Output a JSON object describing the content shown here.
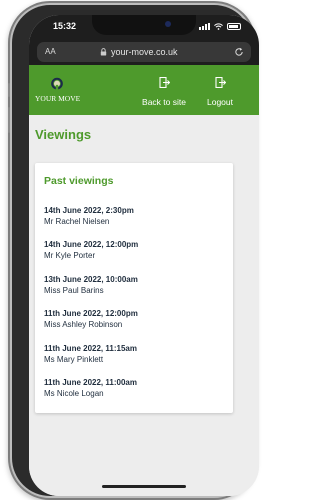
{
  "status_bar": {
    "time": "15:32"
  },
  "browser": {
    "text_size_label": "AA",
    "url": "your-move.co.uk"
  },
  "header": {
    "logo_text": "YOUR MOVE",
    "back_label": "Back to site",
    "logout_label": "Logout",
    "color": "#4e9a2c"
  },
  "page": {
    "title": "Viewings"
  },
  "card": {
    "title": "Past viewings",
    "viewings": [
      {
        "datetime": "14th June 2022, 2:30pm",
        "name": "Mr Rachel Nielsen"
      },
      {
        "datetime": "14th June 2022, 12:00pm",
        "name": "Mr Kyle Porter"
      },
      {
        "datetime": "13th June 2022, 10:00am",
        "name": "Miss Paul Barins"
      },
      {
        "datetime": "11th June 2022, 12:00pm",
        "name": "Miss Ashley Robinson"
      },
      {
        "datetime": "11th June 2022, 11:15am",
        "name": "Ms Mary Pinklett"
      },
      {
        "datetime": "11th June 2022, 11:00am",
        "name": "Ms Nicole Logan"
      }
    ]
  }
}
